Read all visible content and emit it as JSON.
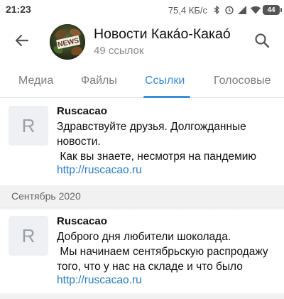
{
  "status_bar": {
    "time": "21:23",
    "speed": "75,4 КБ/с",
    "battery": "44",
    "icons": [
      "bluetooth-icon",
      "alarm-icon",
      "signal-icon",
      "wifi-icon",
      "battery-icon"
    ]
  },
  "header": {
    "title": "Новости Какáо-Какаó",
    "subtitle": "49 ссылок",
    "avatar_text": "NEWS",
    "icons": [
      "back-arrow-icon",
      "search-icon"
    ]
  },
  "tabs": [
    {
      "label": "Медиа",
      "active": false
    },
    {
      "label": "Файлы",
      "active": false
    },
    {
      "label": "Ссылки",
      "active": true
    },
    {
      "label": "Голосовые",
      "active": false
    }
  ],
  "links": [
    {
      "thumb_letter": "R",
      "title": "Ruscacao",
      "description": "Здравствуйте друзья. Долгожданные новости.\n Как вы знаете, несмотря на пандемию",
      "url": "http://ruscacao.ru"
    },
    {
      "thumb_letter": "R",
      "title": "Ruscacao",
      "description": "Доброго дня любители шоколада.\n Мы начинаем сентябрьскую распродажу того, что у нас на складе и что было",
      "url": "http://ruscacao.ru"
    }
  ],
  "section": {
    "label": "Сентябрь 2020"
  },
  "colors": {
    "accent": "#3a8ed4",
    "link": "#2a7bc0",
    "muted": "#8a8a8a",
    "section_bg": "#f1f1f1",
    "thumb_bg": "#eef0f3"
  }
}
